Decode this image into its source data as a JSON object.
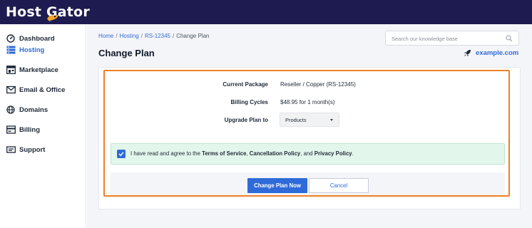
{
  "brand": {
    "name": "Host Gator"
  },
  "sidebar": {
    "items": [
      {
        "label": "Dashboard",
        "icon": "dashboard-icon"
      },
      {
        "label": "Hosting",
        "icon": "hosting-icon",
        "active": true
      },
      {
        "label": "Marketplace",
        "icon": "marketplace-icon"
      },
      {
        "label": "Email & Office",
        "icon": "email-icon"
      },
      {
        "label": "Domains",
        "icon": "globe-icon"
      },
      {
        "label": "Billing",
        "icon": "billing-icon"
      },
      {
        "label": "Support",
        "icon": "support-icon"
      }
    ]
  },
  "breadcrumb": {
    "items": [
      "Home",
      "Hosting",
      "RS-12345",
      "Change Plan"
    ],
    "separator": "/"
  },
  "page": {
    "title": "Change Plan"
  },
  "search": {
    "placeholder": "Search our knowledge base"
  },
  "domain": {
    "name": "example.com"
  },
  "form": {
    "current_package": {
      "label": "Current Package",
      "value": "Reseller / Copper (RS-12345)"
    },
    "billing_cycles": {
      "label": "Billing Cycles",
      "value": "$48.95 for 1 month(s)"
    },
    "upgrade_plan": {
      "label": "Upgrade Plan to",
      "selected": "Products"
    }
  },
  "agreement": {
    "checked": true,
    "prefix": "I have read and agree to the ",
    "terms": "Terms of Service",
    "comma": ", ",
    "cancellation": "Cancellation Policy",
    "and": ", and ",
    "privacy": "Privacy Policy",
    "suffix": "."
  },
  "actions": {
    "primary": "Change Plan Now",
    "secondary": "Cancel"
  },
  "colors": {
    "topbar": "#1d1b4f",
    "accent": "#2e6bd9",
    "highlight": "#f07f24",
    "agree_bg": "#e3f6ec"
  }
}
